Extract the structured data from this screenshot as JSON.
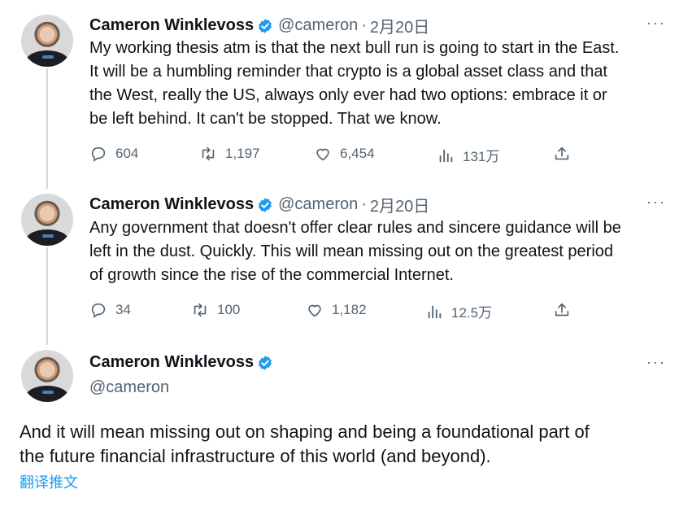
{
  "tweets": [
    {
      "name": "Cameron Winklevoss",
      "handle": "@cameron",
      "sep": "·",
      "date": "2月20日",
      "text": "My working thesis atm is that the next bull run is going to start in the East.\nIt will be a humbling reminder that crypto is a global asset class and that\nthe West, really the US, always only ever had two options: embrace it or\nbe left behind. It can't be stopped. That we know.",
      "replies": "604",
      "retweets": "1,197",
      "likes": "6,454",
      "views": "131万"
    },
    {
      "name": "Cameron Winklevoss",
      "handle": "@cameron",
      "sep": "·",
      "date": "2月20日",
      "text": "Any government that doesn't offer clear rules and sincere guidance will be\nleft in the dust. Quickly. This will mean missing out on the greatest period\nof growth since the rise of the commercial Internet.",
      "replies": "34",
      "retweets": "100",
      "likes": "1,182",
      "views": "12.5万"
    },
    {
      "name": "Cameron Winklevoss",
      "handle": "@cameron",
      "text": "And it will mean missing out on shaping and being a foundational part of\nthe future financial infrastructure of this world (and beyond).",
      "translate": "翻译推文"
    }
  ],
  "more_label": "···",
  "colors": {
    "verified": "#1d9bf0",
    "link": "#1d9bf0",
    "muted": "#536471"
  }
}
